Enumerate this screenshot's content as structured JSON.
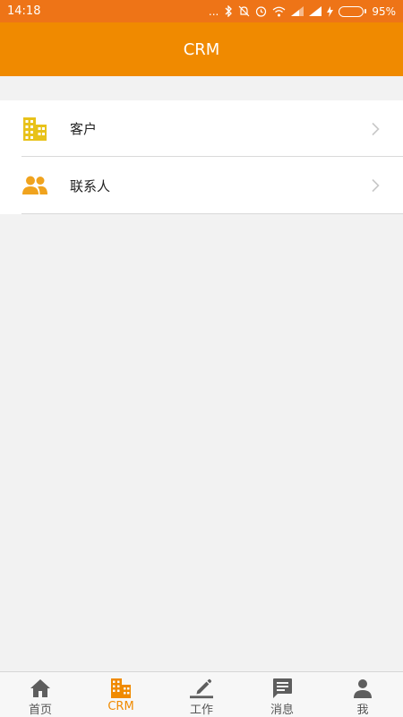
{
  "status_bar": {
    "time": "14:18",
    "icons": [
      "dots-icon",
      "bluetooth-icon",
      "mute-bell-icon",
      "alarm-icon",
      "wifi-icon",
      "signal-icon",
      "signal-icon",
      "charging-icon"
    ],
    "dots": "...",
    "battery_percent": "95%",
    "battery_level": 0.95
  },
  "app_bar": {
    "title": "CRM"
  },
  "menu": {
    "items": [
      {
        "label": "客户",
        "icon": "building-icon",
        "icon_color": "#e8c21a"
      },
      {
        "label": "联系人",
        "icon": "people-icon",
        "icon_color": "#f0a31e"
      }
    ]
  },
  "tab_bar": {
    "active_color": "#f08a00",
    "inactive_color": "#555555",
    "items": [
      {
        "label": "首页",
        "icon": "home-icon"
      },
      {
        "label": "CRM",
        "icon": "building-icon",
        "active": true
      },
      {
        "label": "工作",
        "icon": "pencil-icon"
      },
      {
        "label": "消息",
        "icon": "message-icon"
      },
      {
        "label": "我",
        "icon": "person-icon"
      }
    ]
  }
}
